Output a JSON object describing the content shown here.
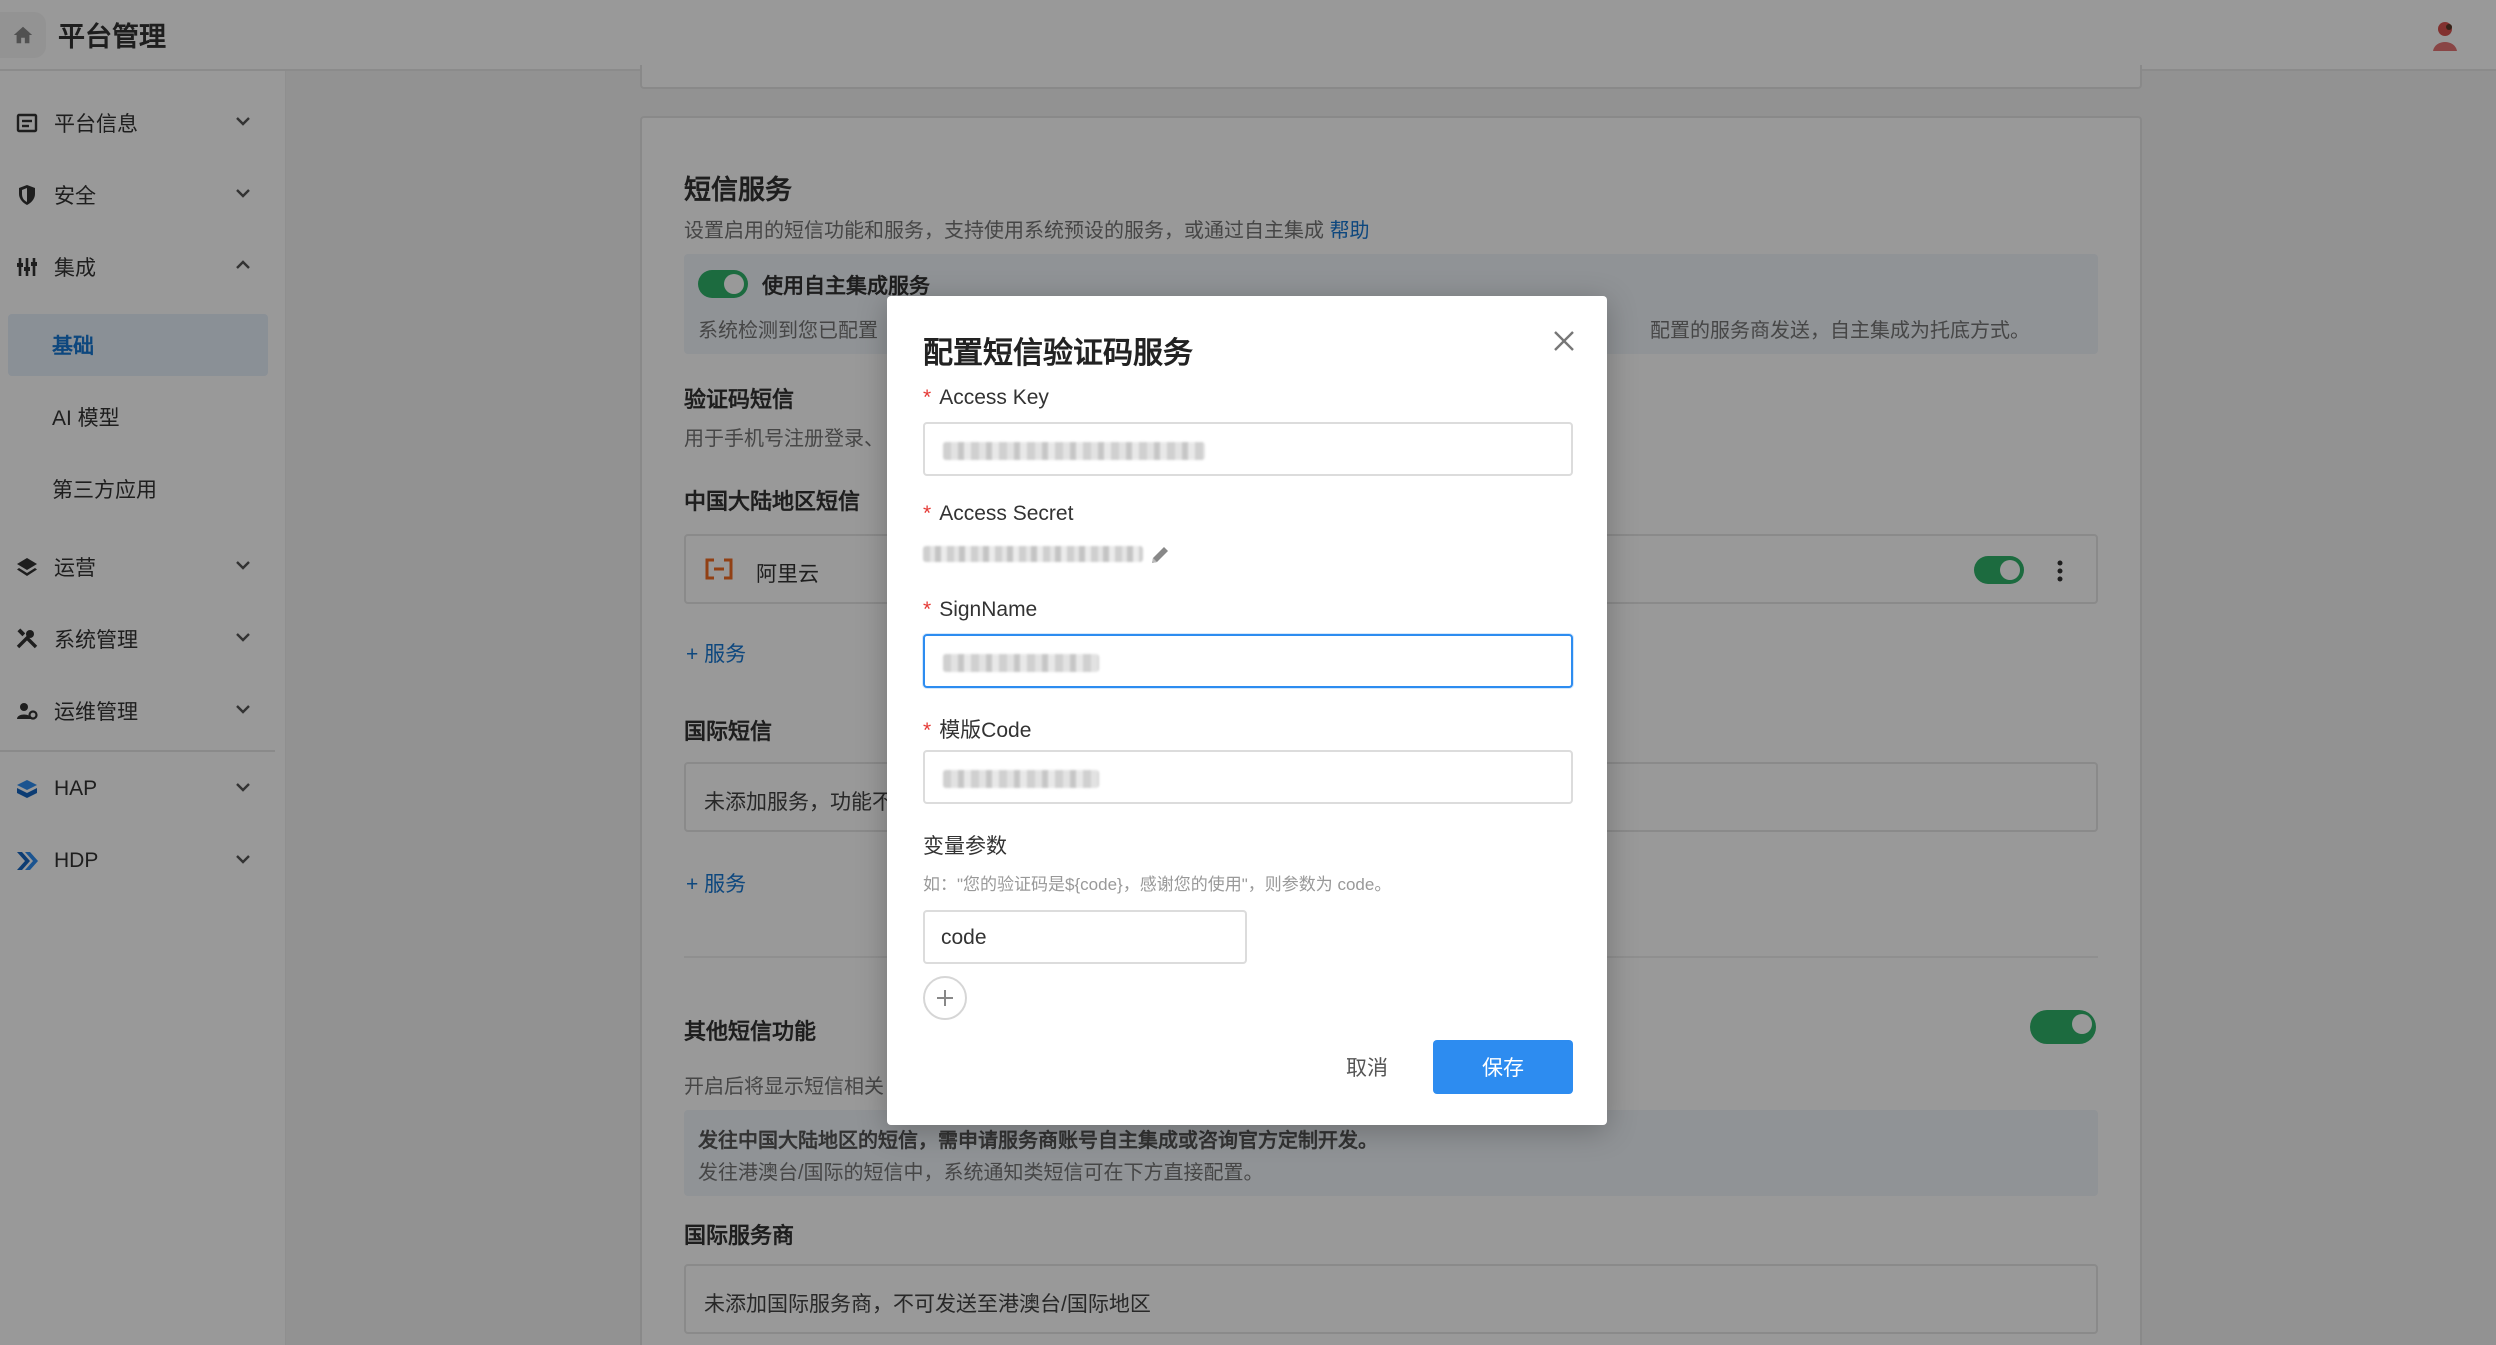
{
  "header": {
    "title": "平台管理"
  },
  "sidebar": {
    "items": [
      {
        "label": "平台信息",
        "icon": "document-icon"
      },
      {
        "label": "安全",
        "icon": "shield-icon"
      },
      {
        "label": "集成",
        "icon": "sliders-icon"
      },
      {
        "label": "运营",
        "icon": "layers-icon"
      },
      {
        "label": "系统管理",
        "icon": "tools-icon"
      },
      {
        "label": "运维管理",
        "icon": "user-gear-icon"
      },
      {
        "label": "HAP",
        "icon": "hap-logo-icon"
      },
      {
        "label": "HDP",
        "icon": "hdp-logo-icon"
      }
    ],
    "sub_items": [
      {
        "label": "基础",
        "active": true
      },
      {
        "label": "AI 模型",
        "active": false
      },
      {
        "label": "第三方应用",
        "active": false
      }
    ]
  },
  "main": {
    "sms_title": "短信服务",
    "sms_desc": "设置启用的短信功能和服务，支持使用系统预设的服务，或通过自主集成",
    "help_link": "帮助",
    "self_integration_label": "使用自主集成服务",
    "self_integration_desc_left": "系统检测到您已配置",
    "self_integration_desc_right": "配置的服务商发送，自主集成为托底方式。",
    "verify_title": "验证码短信",
    "verify_desc": "用于手机号注册登录、",
    "mainland_title": "中国大陆地区短信",
    "provider_name": "阿里云",
    "add_service": "+ 服务",
    "intl_title": "国际短信",
    "intl_empty": "未添加服务，功能不",
    "add_service_2": "+ 服务",
    "other_title": "其他短信功能",
    "other_desc": "开启后将显示短信相关",
    "notice_line1": "发往中国大陆地区的短信，需申请服务商账号自主集成或咨询官方定制开发。",
    "notice_line2": "发往港澳台/国际的短信中，系统通知类短信可在下方直接配置。",
    "intl_provider_title": "国际服务商",
    "intl_provider_empty": "未添加国际服务商，不可发送至港澳台/国际地区"
  },
  "modal": {
    "title": "配置短信验证码服务",
    "access_key_label": "Access Key",
    "access_secret_label": "Access Secret",
    "sign_name_label": "SignName",
    "template_code_label": "模版Code",
    "variables_label": "变量参数",
    "variables_hint": "如：\"您的验证码是${code}，感谢您的使用\"，则参数为 code。",
    "variable_value": "code",
    "cancel_label": "取消",
    "save_label": "保存"
  },
  "colors": {
    "accent": "#2d8cf0",
    "toggle_on": "#2fb26a",
    "active_nav": "#1677d2"
  }
}
